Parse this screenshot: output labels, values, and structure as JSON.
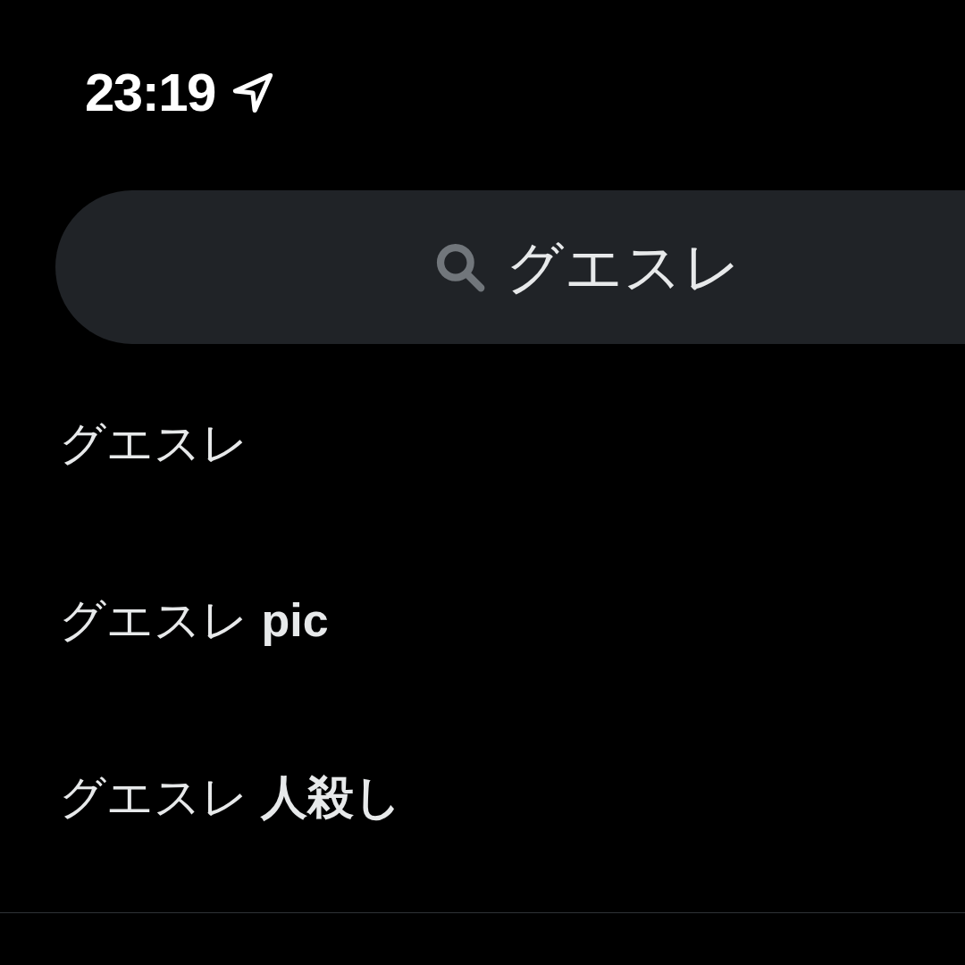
{
  "status_bar": {
    "time": "23:19"
  },
  "search": {
    "value": "グエスレ"
  },
  "suggestions": [
    {
      "text": "グエスレ"
    },
    {
      "text": "グエスレ **pic**"
    },
    {
      "text": "グエスレ **人殺し**"
    }
  ]
}
